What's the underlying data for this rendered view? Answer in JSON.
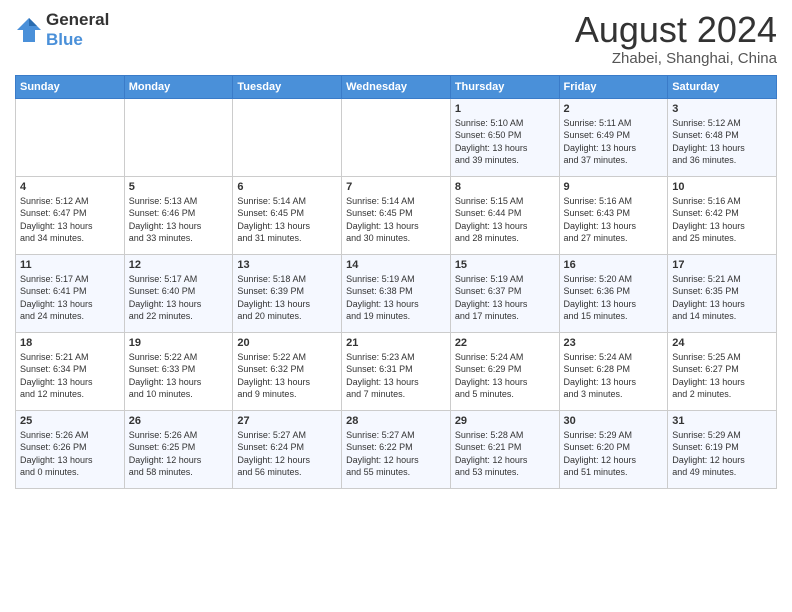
{
  "header": {
    "logo_general": "General",
    "logo_blue": "Blue",
    "month_title": "August 2024",
    "location": "Zhabei, Shanghai, China"
  },
  "weekdays": [
    "Sunday",
    "Monday",
    "Tuesday",
    "Wednesday",
    "Thursday",
    "Friday",
    "Saturday"
  ],
  "weeks": [
    [
      {
        "day": "",
        "info": ""
      },
      {
        "day": "",
        "info": ""
      },
      {
        "day": "",
        "info": ""
      },
      {
        "day": "",
        "info": ""
      },
      {
        "day": "1",
        "info": "Sunrise: 5:10 AM\nSunset: 6:50 PM\nDaylight: 13 hours\nand 39 minutes."
      },
      {
        "day": "2",
        "info": "Sunrise: 5:11 AM\nSunset: 6:49 PM\nDaylight: 13 hours\nand 37 minutes."
      },
      {
        "day": "3",
        "info": "Sunrise: 5:12 AM\nSunset: 6:48 PM\nDaylight: 13 hours\nand 36 minutes."
      }
    ],
    [
      {
        "day": "4",
        "info": "Sunrise: 5:12 AM\nSunset: 6:47 PM\nDaylight: 13 hours\nand 34 minutes."
      },
      {
        "day": "5",
        "info": "Sunrise: 5:13 AM\nSunset: 6:46 PM\nDaylight: 13 hours\nand 33 minutes."
      },
      {
        "day": "6",
        "info": "Sunrise: 5:14 AM\nSunset: 6:45 PM\nDaylight: 13 hours\nand 31 minutes."
      },
      {
        "day": "7",
        "info": "Sunrise: 5:14 AM\nSunset: 6:45 PM\nDaylight: 13 hours\nand 30 minutes."
      },
      {
        "day": "8",
        "info": "Sunrise: 5:15 AM\nSunset: 6:44 PM\nDaylight: 13 hours\nand 28 minutes."
      },
      {
        "day": "9",
        "info": "Sunrise: 5:16 AM\nSunset: 6:43 PM\nDaylight: 13 hours\nand 27 minutes."
      },
      {
        "day": "10",
        "info": "Sunrise: 5:16 AM\nSunset: 6:42 PM\nDaylight: 13 hours\nand 25 minutes."
      }
    ],
    [
      {
        "day": "11",
        "info": "Sunrise: 5:17 AM\nSunset: 6:41 PM\nDaylight: 13 hours\nand 24 minutes."
      },
      {
        "day": "12",
        "info": "Sunrise: 5:17 AM\nSunset: 6:40 PM\nDaylight: 13 hours\nand 22 minutes."
      },
      {
        "day": "13",
        "info": "Sunrise: 5:18 AM\nSunset: 6:39 PM\nDaylight: 13 hours\nand 20 minutes."
      },
      {
        "day": "14",
        "info": "Sunrise: 5:19 AM\nSunset: 6:38 PM\nDaylight: 13 hours\nand 19 minutes."
      },
      {
        "day": "15",
        "info": "Sunrise: 5:19 AM\nSunset: 6:37 PM\nDaylight: 13 hours\nand 17 minutes."
      },
      {
        "day": "16",
        "info": "Sunrise: 5:20 AM\nSunset: 6:36 PM\nDaylight: 13 hours\nand 15 minutes."
      },
      {
        "day": "17",
        "info": "Sunrise: 5:21 AM\nSunset: 6:35 PM\nDaylight: 13 hours\nand 14 minutes."
      }
    ],
    [
      {
        "day": "18",
        "info": "Sunrise: 5:21 AM\nSunset: 6:34 PM\nDaylight: 13 hours\nand 12 minutes."
      },
      {
        "day": "19",
        "info": "Sunrise: 5:22 AM\nSunset: 6:33 PM\nDaylight: 13 hours\nand 10 minutes."
      },
      {
        "day": "20",
        "info": "Sunrise: 5:22 AM\nSunset: 6:32 PM\nDaylight: 13 hours\nand 9 minutes."
      },
      {
        "day": "21",
        "info": "Sunrise: 5:23 AM\nSunset: 6:31 PM\nDaylight: 13 hours\nand 7 minutes."
      },
      {
        "day": "22",
        "info": "Sunrise: 5:24 AM\nSunset: 6:29 PM\nDaylight: 13 hours\nand 5 minutes."
      },
      {
        "day": "23",
        "info": "Sunrise: 5:24 AM\nSunset: 6:28 PM\nDaylight: 13 hours\nand 3 minutes."
      },
      {
        "day": "24",
        "info": "Sunrise: 5:25 AM\nSunset: 6:27 PM\nDaylight: 13 hours\nand 2 minutes."
      }
    ],
    [
      {
        "day": "25",
        "info": "Sunrise: 5:26 AM\nSunset: 6:26 PM\nDaylight: 13 hours\nand 0 minutes."
      },
      {
        "day": "26",
        "info": "Sunrise: 5:26 AM\nSunset: 6:25 PM\nDaylight: 12 hours\nand 58 minutes."
      },
      {
        "day": "27",
        "info": "Sunrise: 5:27 AM\nSunset: 6:24 PM\nDaylight: 12 hours\nand 56 minutes."
      },
      {
        "day": "28",
        "info": "Sunrise: 5:27 AM\nSunset: 6:22 PM\nDaylight: 12 hours\nand 55 minutes."
      },
      {
        "day": "29",
        "info": "Sunrise: 5:28 AM\nSunset: 6:21 PM\nDaylight: 12 hours\nand 53 minutes."
      },
      {
        "day": "30",
        "info": "Sunrise: 5:29 AM\nSunset: 6:20 PM\nDaylight: 12 hours\nand 51 minutes."
      },
      {
        "day": "31",
        "info": "Sunrise: 5:29 AM\nSunset: 6:19 PM\nDaylight: 12 hours\nand 49 minutes."
      }
    ]
  ]
}
